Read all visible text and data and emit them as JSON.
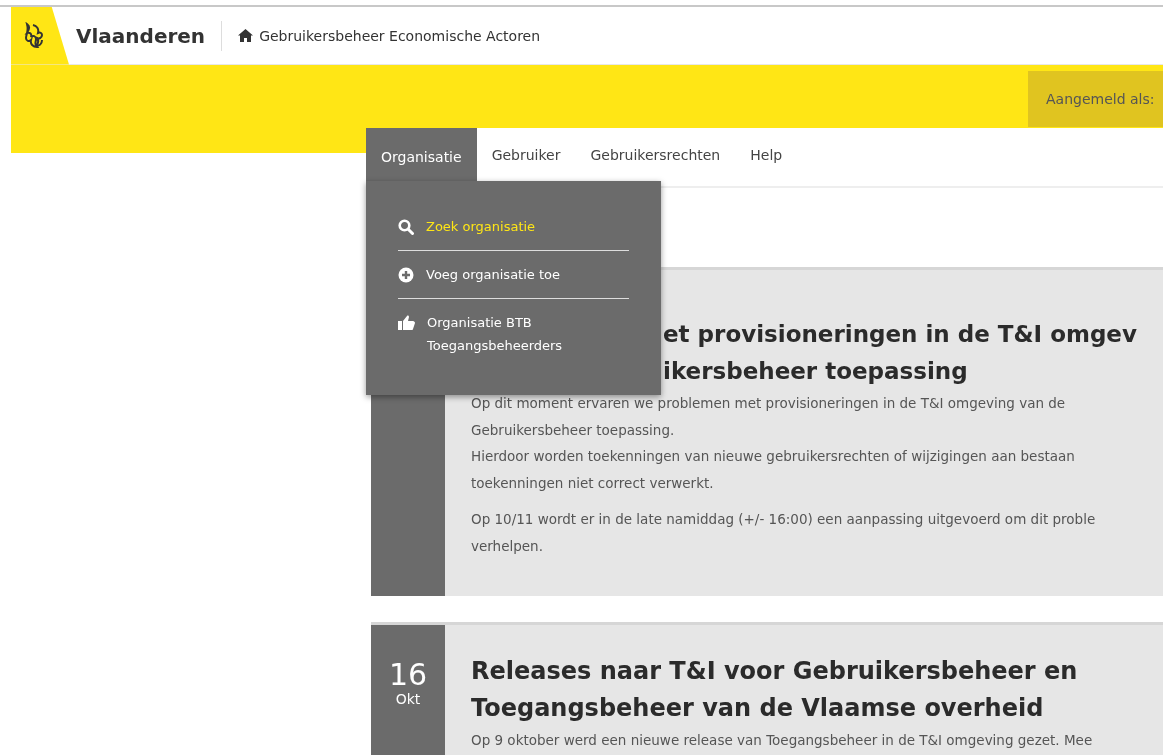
{
  "header": {
    "logo_text": "Vlaanderen",
    "breadcrumb": "Gebruikersbeheer Economische Actoren",
    "user_label": "Aangemeld als:"
  },
  "nav": {
    "tabs": [
      {
        "label": "Organisatie",
        "selected": true
      },
      {
        "label": "Gebruiker",
        "selected": false
      },
      {
        "label": "Gebruikersrechten",
        "selected": false
      },
      {
        "label": "Help",
        "selected": false
      }
    ],
    "dropdown": {
      "items": [
        {
          "label": "Zoek organisatie",
          "kind": "search",
          "selected": true
        },
        {
          "label": "Voeg organisatie toe",
          "kind": "add",
          "selected": false
        },
        {
          "label": "Organisatie BTB Toegangsbeheerders",
          "kind": "thumbs-up",
          "selected": false
        }
      ]
    }
  },
  "news": [
    {
      "title_lines": [
        "et provisioneringen in de T&I omgev",
        "ikersbeheer toepassing"
      ],
      "paragraphs": [
        "Op dit moment ervaren we problemen met provisioneringen in de T&I omgeving van de\nGebruikersbeheer toepassing.\nHierdoor worden toekenningen van nieuwe gebruikersrechten of wijzigingen aan bestaan\ntoekenningen niet correct verwerkt.",
        "Op 10/11 wordt er in de late namiddag (+/- 16:00) een aanpassing uitgevoerd om dit proble\nverhelpen."
      ]
    },
    {
      "day": "16",
      "month": "Okt",
      "title_lines": [
        "Releases naar T&I voor Gebruikersbeheer en",
        "Toegangsbeheer van de Vlaamse overheid"
      ],
      "paragraphs": [
        "Op 9 oktober werd een nieuwe release van Toegangsbeheer in de T&I omgeving gezet. Mee"
      ]
    }
  ]
}
